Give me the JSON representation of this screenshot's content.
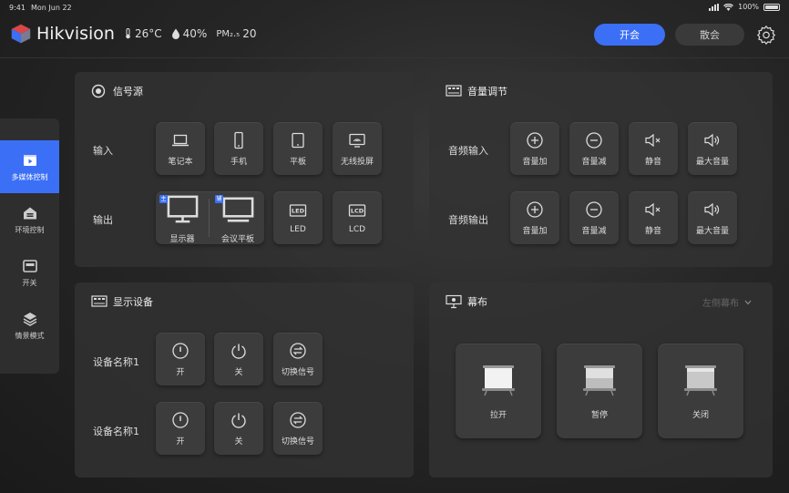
{
  "status": {
    "time": "9:41",
    "date": "Mon Jun 22",
    "battery": "100%"
  },
  "header": {
    "brand": "Hikvision",
    "temperature": "26°C",
    "humidity": "40%",
    "pm_label": "PM₂.₅",
    "pm_value": "20",
    "open_button": "开会",
    "close_button": "散会"
  },
  "sidebar": {
    "items": [
      {
        "label": "多媒体控制",
        "icon": "video-icon",
        "active": true
      },
      {
        "label": "环境控制",
        "icon": "home-icon",
        "active": false
      },
      {
        "label": "开关",
        "icon": "switch-icon",
        "active": false
      },
      {
        "label": "情景模式",
        "icon": "layers-icon",
        "active": false
      }
    ]
  },
  "signal": {
    "title": "信号源",
    "input_label": "输入",
    "inputs": [
      {
        "label": "笔记本",
        "icon": "laptop-icon"
      },
      {
        "label": "手机",
        "icon": "phone-icon"
      },
      {
        "label": "平板",
        "icon": "tablet-icon"
      },
      {
        "label": "无线投屏",
        "icon": "cast-icon"
      }
    ],
    "output_label": "输出",
    "output_group": [
      {
        "label": "显示器",
        "tag": "主",
        "icon": "monitor-icon"
      },
      {
        "label": "会议平板",
        "tag": "辅",
        "icon": "conference-panel-icon"
      }
    ],
    "outputs": [
      {
        "label": "LED",
        "icon": "led-icon",
        "badge": "LED"
      },
      {
        "label": "LCD",
        "icon": "lcd-icon",
        "badge": "LCD"
      }
    ]
  },
  "volume": {
    "title": "音量调节",
    "input_label": "音频输入",
    "output_label": "音频输出",
    "buttons": [
      {
        "label": "音量加",
        "icon": "plus-circle-icon"
      },
      {
        "label": "音量减",
        "icon": "minus-circle-icon"
      },
      {
        "label": "静音",
        "icon": "mute-icon"
      },
      {
        "label": "最大音量",
        "icon": "volume-max-icon"
      }
    ]
  },
  "display": {
    "title": "显示设备",
    "rows": [
      {
        "label": "设备名称1",
        "buttons": [
          {
            "label": "开",
            "icon": "power-on-icon"
          },
          {
            "label": "关",
            "icon": "power-off-icon"
          },
          {
            "label": "切换信号",
            "icon": "switch-signal-icon"
          }
        ]
      },
      {
        "label": "设备名称1",
        "buttons": [
          {
            "label": "开",
            "icon": "power-on-icon"
          },
          {
            "label": "关",
            "icon": "power-off-icon"
          },
          {
            "label": "切换信号",
            "icon": "switch-signal-icon"
          }
        ]
      }
    ]
  },
  "screen": {
    "title": "幕布",
    "selector": "左侧幕布",
    "buttons": [
      {
        "label": "拉开",
        "icon": "screen-open-icon"
      },
      {
        "label": "暂停",
        "icon": "screen-pause-icon"
      },
      {
        "label": "关闭",
        "icon": "screen-close-icon"
      }
    ]
  },
  "colors": {
    "accent": "#3b6ff5",
    "panel": "#323232",
    "tile": "#3c3c3c"
  }
}
